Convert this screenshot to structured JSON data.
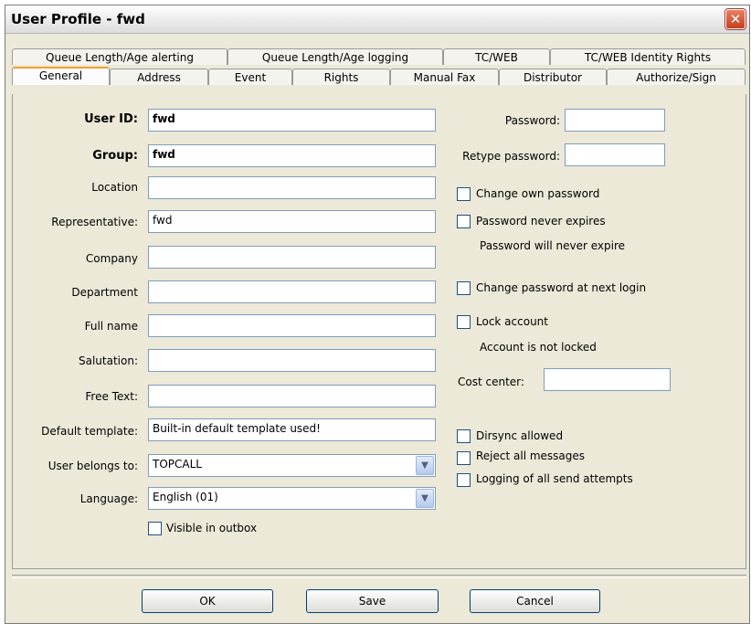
{
  "window": {
    "title": "User Profile - fwd",
    "close_glyph": "✕"
  },
  "tabs": {
    "row1": [
      "Queue Length/Age alerting",
      "Queue Length/Age logging",
      "TC/WEB",
      "TC/WEB Identity Rights"
    ],
    "row2": [
      "General",
      "Address",
      "Event",
      "Rights",
      "Manual Fax",
      "Distributor",
      "Authorize/Sign"
    ],
    "active": "General"
  },
  "form": {
    "user_id": {
      "label": "User ID:",
      "value": "fwd"
    },
    "group": {
      "label": "Group:",
      "value": "fwd"
    },
    "location": {
      "label": "Location",
      "value": ""
    },
    "representative": {
      "label": "Representative:",
      "value": "fwd"
    },
    "company": {
      "label": "Company",
      "value": ""
    },
    "department": {
      "label": "Department",
      "value": ""
    },
    "full_name": {
      "label": "Full name",
      "value": ""
    },
    "salutation": {
      "label": "Salutation:",
      "value": ""
    },
    "free_text": {
      "label": "Free Text:",
      "value": ""
    },
    "default_template": {
      "label": "Default template:",
      "value": "Built-in default template used!"
    },
    "user_belongs_to": {
      "label": "User belongs to:",
      "value": "TOPCALL"
    },
    "language": {
      "label": "Language:",
      "value": "English (01)"
    },
    "visible_in_outbox": {
      "label": "Visible in outbox",
      "checked": false
    }
  },
  "right": {
    "password": {
      "label": "Password:",
      "value": ""
    },
    "retype_password": {
      "label": "Retype password:",
      "value": ""
    },
    "change_own_password": {
      "label": "Change own password",
      "checked": false
    },
    "password_never_expires": {
      "label": "Password never expires",
      "checked": false
    },
    "password_status": "Password will never expire",
    "change_password_next_login": {
      "label": "Change password at next login",
      "checked": false
    },
    "lock_account": {
      "label": "Lock account",
      "checked": false
    },
    "account_status": "Account is not locked",
    "cost_center": {
      "label": "Cost center:",
      "value": ""
    },
    "dirsync_allowed": {
      "label": "Dirsync allowed",
      "checked": false
    },
    "reject_all_messages": {
      "label": "Reject all messages",
      "checked": false
    },
    "logging_all_send_attempts": {
      "label": "Logging of all send attempts",
      "checked": false
    }
  },
  "buttons": {
    "ok": "OK",
    "save": "Save",
    "cancel": "Cancel"
  },
  "icons": {
    "dropdown": "chevron-down-icon",
    "close": "close-icon"
  },
  "colors": {
    "active_tab_accent": "#f0a030",
    "close_button": "#c4401b",
    "input_border": "#7f9db9"
  }
}
